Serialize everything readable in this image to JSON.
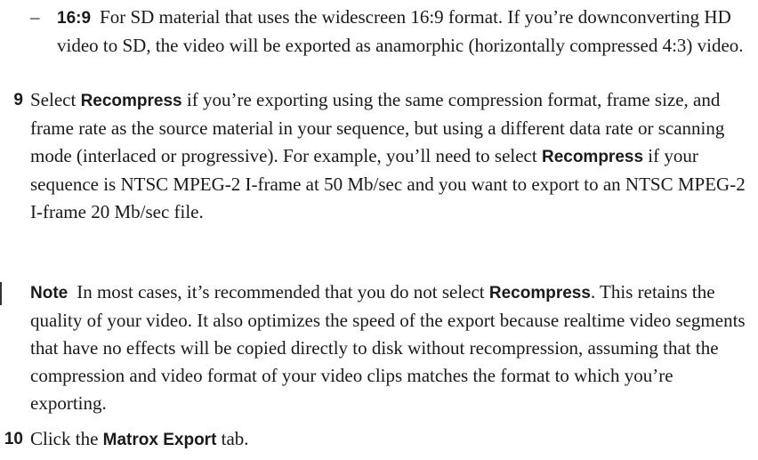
{
  "sub_item": {
    "marker": "–",
    "key": "16:9",
    "text": "For SD material that uses the widescreen 16:9 format. If you’re downconverting HD video to SD, the video will be exported as anamorphic (horizontally compressed 4:3) video."
  },
  "step9": {
    "number": "9",
    "t1": "Select ",
    "b1": "Recompress",
    "t2": " if you’re exporting using the same compression format, frame size, and frame rate as the source material in your sequence, but using a different data rate or scanning mode (interlaced or progressive). For example, you’ll need to select ",
    "b2": "Recompress",
    "t3": " if your sequence is NTSC MPEG-2 I-frame at 50 Mb/sec and you want to export to an NTSC MPEG-2 I-frame 20 Mb/sec file."
  },
  "note": {
    "label": "Note",
    "t1": "In most cases, it’s recommended that you do not select ",
    "b1": "Recompress",
    "t2": ". This retains the quality of your video. It also optimizes the speed of the export because realtime video segments that have no effects will be copied directly to disk without recompression, assuming that the compression and video format of your video clips matches the format to which you’re exporting."
  },
  "step10": {
    "number": "10",
    "t1": "Click the ",
    "b1": "Matrox Export",
    "t2": " tab."
  }
}
